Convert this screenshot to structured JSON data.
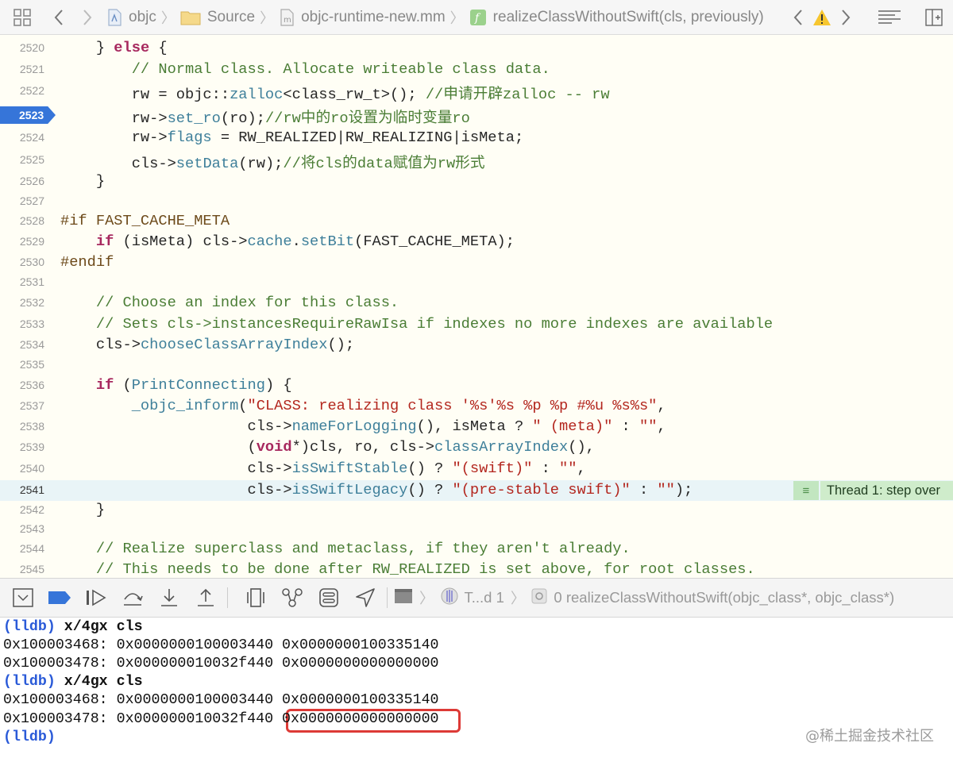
{
  "jumpbar": {
    "crumbs": [
      "objc",
      "Source",
      "objc-runtime-new.mm",
      "realizeClassWithoutSwift(cls, previously)"
    ],
    "icons": [
      "grid-icon",
      "back-arrow-icon",
      "forward-arrow-icon",
      "project-icon",
      "folder-icon",
      "file-icon",
      "function-icon",
      "prev-issue-icon",
      "warning-icon",
      "next-issue-icon",
      "lines-icon",
      "add-editor-icon"
    ]
  },
  "editor": {
    "breakpoint_line": "2523",
    "current_line": "2541",
    "thread_badge": "Thread 1: step over",
    "lines": [
      {
        "n": "2520",
        "html": "    } <span class=\"kw\">else</span> {"
      },
      {
        "n": "2521",
        "html": "        <span class=\"cm\">// Normal class. Allocate writeable class data.</span>"
      },
      {
        "n": "2522",
        "html": "        rw = objc::<span class=\"fn\">zalloc</span>&lt;class_rw_t&gt;(); <span class=\"cm\">//申请开辟zalloc -- rw</span>"
      },
      {
        "n": "2523",
        "html": "        rw-&gt;<span class=\"fn\">set_ro</span>(ro);<span class=\"cm\">//rw中的ro设置为临时变量ro</span>"
      },
      {
        "n": "2524",
        "html": "        rw-&gt;<span class=\"fn\">flags</span> = RW_REALIZED|RW_REALIZING|isMeta;"
      },
      {
        "n": "2525",
        "html": "        cls-&gt;<span class=\"fn\">setData</span>(rw);<span class=\"cm\">//将cls的data赋值为rw形式</span>"
      },
      {
        "n": "2526",
        "html": "    }"
      },
      {
        "n": "2527",
        "html": ""
      },
      {
        "n": "2528",
        "html": "<span class=\"pp\">#if FAST_CACHE_META</span>"
      },
      {
        "n": "2529",
        "html": "    <span class=\"kw\">if</span> (isMeta) cls-&gt;<span class=\"fn\">cache</span>.<span class=\"fn\">setBit</span>(FAST_CACHE_META);"
      },
      {
        "n": "2530",
        "html": "<span class=\"pp\">#endif</span>"
      },
      {
        "n": "2531",
        "html": ""
      },
      {
        "n": "2532",
        "html": "    <span class=\"cm\">// Choose an index for this class.</span>"
      },
      {
        "n": "2533",
        "html": "    <span class=\"cm\">// Sets cls-&gt;instancesRequireRawIsa if indexes no more indexes are available</span>"
      },
      {
        "n": "2534",
        "html": "    cls-&gt;<span class=\"fn\">chooseClassArrayIndex</span>();"
      },
      {
        "n": "2535",
        "html": ""
      },
      {
        "n": "2536",
        "html": "    <span class=\"kw\">if</span> (<span class=\"fn\">PrintConnecting</span>) {"
      },
      {
        "n": "2537",
        "html": "        <span class=\"fn\">_objc_inform</span>(<span class=\"st\">\"CLASS: realizing class '%s'%s %p %p #%u %s%s\"</span>,"
      },
      {
        "n": "2538",
        "html": "                     cls-&gt;<span class=\"fn\">nameForLogging</span>(), isMeta ? <span class=\"st\">\" (meta)\"</span> : <span class=\"st\">\"\"</span>,"
      },
      {
        "n": "2539",
        "html": "                     (<span class=\"kw\">void</span>*)cls, ro, cls-&gt;<span class=\"fn\">classArrayIndex</span>(),"
      },
      {
        "n": "2540",
        "html": "                     cls-&gt;<span class=\"fn\">isSwiftStable</span>() ? <span class=\"st\">\"(swift)\"</span> : <span class=\"st\">\"\"</span>,"
      },
      {
        "n": "2541",
        "html": "                     cls-&gt;<span class=\"fn\">isSwiftLegacy</span>() ? <span class=\"st\">\"(pre-stable swift)\"</span> : <span class=\"st\">\"\"</span>);"
      },
      {
        "n": "2542",
        "html": "    }"
      },
      {
        "n": "2543",
        "html": ""
      },
      {
        "n": "2544",
        "html": "    <span class=\"cm\">// Realize superclass and metaclass, if they aren't already.</span>"
      },
      {
        "n": "2545",
        "html": "    <span class=\"cm\">// This needs to be done after RW_REALIZED is set above, for root classes.</span>"
      }
    ]
  },
  "debugbar": {
    "thread_label": "T...d 1",
    "frame_label": "0 realizeClassWithoutSwift(objc_class*, objc_class*)"
  },
  "console": {
    "lines": [
      {
        "type": "cmd",
        "prompt": "(lldb)",
        "text": " x/4gx cls"
      },
      {
        "type": "out",
        "text": "0x100003468: 0x0000000100003440 0x0000000100335140"
      },
      {
        "type": "out",
        "text": "0x100003478: 0x000000010032f440 0x0000000000000000"
      },
      {
        "type": "cmd",
        "prompt": "(lldb)",
        "text": " x/4gx cls"
      },
      {
        "type": "out",
        "text": "0x100003468: 0x0000000100003440 0x0000000100335140"
      },
      {
        "type": "out",
        "text": "0x100003478: 0x000000010032f440 0x0000000000000000"
      },
      {
        "type": "cmd",
        "prompt": "(lldb)",
        "text": ""
      }
    ],
    "watermark": "@稀土掘金技术社区"
  },
  "colors": {
    "breakpoint": "#3675d9",
    "current_line": "#e9f4f7",
    "thread_badge": "#cfeccb",
    "highlight_box": "#dd3a36",
    "lldb_prompt": "#2a5ad8"
  }
}
